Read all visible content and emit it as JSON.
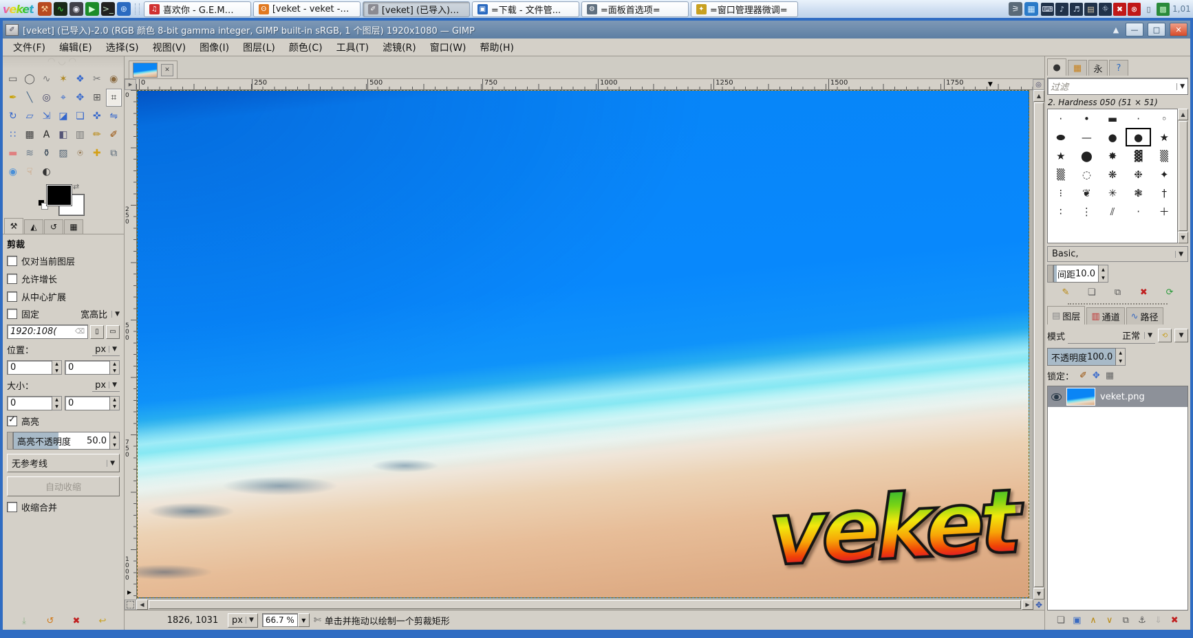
{
  "taskbar": {
    "logo": "veket",
    "launchers": [
      {
        "n": "setup-hammer-icon",
        "g": "⚒",
        "bg": "#b84a20",
        "c": "#ffd8a0"
      },
      {
        "n": "system-monitor-icon",
        "g": "∿",
        "bg": "#1a2a1a",
        "c": "#40e040"
      },
      {
        "n": "media-player-icon",
        "g": "◉",
        "bg": "#404048",
        "c": "#e8e8f0"
      },
      {
        "n": "play-green-icon",
        "g": "▶",
        "bg": "#1c8c28",
        "c": "#d8ffd8"
      },
      {
        "n": "terminal-icon",
        "g": ">_",
        "bg": "#202020",
        "c": "#c0e0c0"
      },
      {
        "n": "browser-globe-icon",
        "g": "⊕",
        "bg": "#2a6ac0",
        "c": "#cfe6ff"
      }
    ],
    "windows": [
      {
        "icon": "♫",
        "bg": "#d03030",
        "label": "喜欢你 - G.E.M…",
        "cls": ""
      },
      {
        "icon": "ʘ",
        "bg": "#e07820",
        "label": "[veket - veket -…",
        "cls": ""
      },
      {
        "icon": "✐",
        "bg": "#8a8a92",
        "label": "[veket] (已导入)…",
        "cls": "active"
      },
      {
        "icon": "▣",
        "bg": "#2a6ac0",
        "label": "=下载 - 文件管...",
        "cls": ""
      },
      {
        "icon": "⚙",
        "bg": "#607080",
        "label": "=面板首选项=",
        "cls": ""
      },
      {
        "icon": "✦",
        "bg": "#c8a020",
        "label": "=窗口管理器微调=",
        "cls": ""
      }
    ],
    "extra_buttons": [
      {
        "n": "screenshot-tool-icon",
        "g": "⚞",
        "bg": "#5a6a78",
        "c": "#e8eef4"
      },
      {
        "n": "wallpaper-preview-icon",
        "g": "▦",
        "bg": "#2a7ac8",
        "c": "#d0ecff"
      }
    ],
    "tray": [
      {
        "n": "keyboard-layout-icon",
        "g": "⌨",
        "bg": "#20324a",
        "c": "#e8f0ff"
      },
      {
        "n": "volume-icon",
        "g": "♪",
        "bg": "#20324a",
        "c": "#cfe0f4"
      },
      {
        "n": "mixer-icon",
        "g": "♬",
        "bg": "#20324a",
        "c": "#cfe0f4"
      },
      {
        "n": "clipboard-tray-icon",
        "g": "▤",
        "bg": "#20324a",
        "c": "#d8c8a8"
      },
      {
        "n": "network-signal-icon",
        "g": "⛗",
        "bg": "#20324a",
        "c": "#cfe0f4"
      },
      {
        "n": "firewall-x-icon",
        "g": "✖",
        "bg": "#c01818",
        "c": "#ffffff"
      },
      {
        "n": "blocked-x-icon",
        "g": "⊗",
        "bg": "#c01818",
        "c": "#ffffff"
      },
      {
        "n": "clipboard-icon",
        "g": "▯",
        "bg": "transparent",
        "c": "#4a5a68"
      },
      {
        "n": "cpu-chip-icon",
        "g": "▩",
        "bg": "#2a8a3a",
        "c": "#bff0c0"
      }
    ],
    "clock": "1,01"
  },
  "window": {
    "title": "[veket] (已导入)-2.0 (RGB 颜色 8-bit gamma integer, GIMP built-in sRGB, 1 个图层) 1920x1080 — GIMP",
    "shade_glyph": "▲",
    "minimize_glyph": "—",
    "maximize_glyph": "□",
    "close_glyph": "✕",
    "menus": [
      "文件(F)",
      "编辑(E)",
      "选择(S)",
      "视图(V)",
      "图像(I)",
      "图层(L)",
      "颜色(C)",
      "工具(T)",
      "滤镜(R)",
      "窗口(W)",
      "帮助(H)"
    ]
  },
  "toolbox": {
    "tools": [
      {
        "n": "rect-select-tool",
        "g": "▭",
        "c": "#555",
        "cls": ""
      },
      {
        "n": "ellipse-select-tool",
        "g": "◯",
        "c": "#555",
        "cls": ""
      },
      {
        "n": "free-select-tool",
        "g": "∿",
        "c": "#777",
        "cls": ""
      },
      {
        "n": "fuzzy-select-tool",
        "g": "✶",
        "c": "#b08820",
        "cls": ""
      },
      {
        "n": "select-by-color-tool",
        "g": "❖",
        "c": "#3366cc",
        "cls": ""
      },
      {
        "n": "scissors-select-tool",
        "g": "✂",
        "c": "#777",
        "cls": ""
      },
      {
        "n": "foreground-select-tool",
        "g": "◉",
        "c": "#8a6a40",
        "cls": ""
      },
      {
        "n": "paths-tool",
        "g": "✒",
        "c": "#c8a000",
        "cls": ""
      },
      {
        "n": "color-picker-tool",
        "g": "╲",
        "c": "#446688",
        "cls": ""
      },
      {
        "n": "zoom-tool",
        "g": "◎",
        "c": "#446",
        "cls": ""
      },
      {
        "n": "measure-tool",
        "g": "⌖",
        "c": "#36c",
        "cls": ""
      },
      {
        "n": "move-tool",
        "g": "✥",
        "c": "#36c",
        "cls": ""
      },
      {
        "n": "align-tool",
        "g": "⊞",
        "c": "#555",
        "cls": ""
      },
      {
        "n": "crop-tool",
        "g": "⌗",
        "c": "#333",
        "cls": "selected"
      },
      {
        "n": "rotate-tool",
        "g": "↻",
        "c": "#36c",
        "cls": ""
      },
      {
        "n": "shear-tool",
        "g": "▱",
        "c": "#36c",
        "cls": ""
      },
      {
        "n": "scale-tool",
        "g": "⇲",
        "c": "#36c",
        "cls": ""
      },
      {
        "n": "perspective-tool",
        "g": "◪",
        "c": "#36c",
        "cls": ""
      },
      {
        "n": "unified-transform-tool",
        "g": "❏",
        "c": "#36c",
        "cls": ""
      },
      {
        "n": "handle-transform-tool",
        "g": "✜",
        "c": "#36c",
        "cls": ""
      },
      {
        "n": "flip-tool",
        "g": "⇋",
        "c": "#36c",
        "cls": ""
      },
      {
        "n": "cage-transform-tool",
        "g": "∷",
        "c": "#36c",
        "cls": ""
      },
      {
        "n": "warp-transform-tool",
        "g": "▩",
        "c": "#444",
        "cls": ""
      },
      {
        "n": "text-tool",
        "g": "A",
        "c": "#222",
        "cls": ""
      },
      {
        "n": "bucket-fill-tool",
        "g": "◧",
        "c": "#557",
        "cls": ""
      },
      {
        "n": "gradient-tool",
        "g": "▥",
        "c": "#777",
        "cls": ""
      },
      {
        "n": "pencil-tool",
        "g": "✏",
        "c": "#b8860b",
        "cls": ""
      },
      {
        "n": "paintbrush-tool",
        "g": "✐",
        "c": "#964b00",
        "cls": ""
      },
      {
        "n": "eraser-tool",
        "g": "▬",
        "c": "#e08080",
        "cls": ""
      },
      {
        "n": "airbrush-tool",
        "g": "≋",
        "c": "#678",
        "cls": ""
      },
      {
        "n": "ink-tool",
        "g": "⚱",
        "c": "#345",
        "cls": ""
      },
      {
        "n": "mypaint-brush-tool",
        "g": "▨",
        "c": "#567",
        "cls": ""
      },
      {
        "n": "clone-tool",
        "g": "⍟",
        "c": "#8a6a40",
        "cls": ""
      },
      {
        "n": "heal-tool",
        "g": "✚",
        "c": "#d4a017",
        "cls": ""
      },
      {
        "n": "perspective-clone-tool",
        "g": "⧉",
        "c": "#567",
        "cls": ""
      },
      {
        "n": "blur-sharpen-tool",
        "g": "◉",
        "c": "#4a90d8",
        "cls": ""
      },
      {
        "n": "smudge-tool",
        "g": "☟",
        "c": "#c89060",
        "cls": ""
      },
      {
        "n": "dodge-burn-tool",
        "g": "◐",
        "c": "#333",
        "cls": ""
      }
    ],
    "bottom_buttons": [
      {
        "n": "save-tool-options-button",
        "g": "⤓",
        "c": "#3a8a3a",
        "cls": "disabled-ico"
      },
      {
        "n": "restore-tool-options-button",
        "g": "↺",
        "c": "#d07818",
        "cls": ""
      },
      {
        "n": "delete-tool-options-button",
        "g": "✖",
        "c": "#c02020",
        "cls": ""
      },
      {
        "n": "reset-tool-options-button",
        "g": "↩",
        "c": "#c8a020",
        "cls": ""
      }
    ]
  },
  "tool_options": {
    "tabs": [
      {
        "n": "tab-tool-options",
        "g": "⚒",
        "cls": "active"
      },
      {
        "n": "tab-device-status",
        "g": "◭",
        "cls": ""
      },
      {
        "n": "tab-undo-history",
        "g": "↺",
        "cls": ""
      },
      {
        "n": "tab-image-thumb",
        "g": "▦",
        "cls": ""
      }
    ],
    "title": "剪裁",
    "checkboxes": [
      {
        "label": "仅对当前图层"
      },
      {
        "label": "允许增长"
      },
      {
        "label": "从中心扩展"
      }
    ],
    "fixed_label": "固定",
    "fixed_mode": "宽高比",
    "ratio_value": "1920:108(",
    "ratio_clear_glyph": "⌫",
    "position_label": "位置：",
    "position_unit": "px",
    "position_x": "0",
    "position_y": "0",
    "size_label": "大小：",
    "size_unit": "px",
    "size_x": "0",
    "size_y": "0",
    "highlight_label": "高亮",
    "highlight_opacity_label": "高亮不透明度",
    "highlight_opacity_value": "50.0",
    "guides_value": "无参考线",
    "autoshrink_label": "自动收缩",
    "shrink_merged_label": "收缩合并"
  },
  "canvas": {
    "ruler_h": [
      {
        "t": "0",
        "x": "0.3%"
      },
      {
        "t": "250",
        "x": "12.9%"
      },
      {
        "t": "500",
        "x": "25.8%"
      },
      {
        "t": "750",
        "x": "38.6%"
      },
      {
        "t": "1000",
        "x": "51.5%"
      },
      {
        "t": "1250",
        "x": "64.4%"
      },
      {
        "t": "1500",
        "x": "77.2%"
      },
      {
        "t": "1750",
        "x": "90.1%"
      }
    ],
    "ruler_v": [
      {
        "t": "0",
        "y": "0.5%"
      },
      {
        "t": "250",
        "y": "22.9%"
      },
      {
        "t": "500",
        "y": "45.8%"
      },
      {
        "t": "750",
        "y": "68.7%"
      },
      {
        "t": "1000",
        "y": "91.6%"
      }
    ],
    "image_text": "veket",
    "tab_close_glyph": "✕"
  },
  "statusbar": {
    "position": "1826, 1031",
    "unit": "px",
    "zoom": "66.7 %",
    "hint": "单击并拖动以绘制一个剪裁矩形"
  },
  "brushes": {
    "tabs": [
      {
        "n": "tab-brushes",
        "g": "●",
        "cls": "active",
        "c": "#333"
      },
      {
        "n": "tab-patterns",
        "g": "▦",
        "cls": "",
        "c": "#c8821e"
      },
      {
        "n": "tab-fonts",
        "g": "永",
        "cls": "",
        "c": "#222"
      },
      {
        "n": "tab-document-history",
        "g": "?",
        "cls": "",
        "c": "#2a6ac0"
      }
    ],
    "filter_placeholder": "过滤",
    "selected_label": "2. Hardness 050 (51 × 51)",
    "items": [
      {
        "g": "·",
        "cls": ""
      },
      {
        "g": "•",
        "cls": ""
      },
      {
        "g": "▬",
        "cls": ""
      },
      {
        "g": "·",
        "cls": ""
      },
      {
        "g": "◦",
        "cls": ""
      },
      {
        "g": "⬬",
        "cls": ""
      },
      {
        "g": "—",
        "cls": ""
      },
      {
        "g": "●",
        "cls": ""
      },
      {
        "g": "●",
        "cls": "selected"
      },
      {
        "g": "★",
        "cls": ""
      },
      {
        "g": "★",
        "cls": ""
      },
      {
        "g": "⬤",
        "cls": ""
      },
      {
        "g": "✸",
        "cls": ""
      },
      {
        "g": "▓",
        "cls": ""
      },
      {
        "g": "▒",
        "cls": ""
      },
      {
        "g": "▒",
        "cls": ""
      },
      {
        "g": "◌",
        "cls": ""
      },
      {
        "g": "❋",
        "cls": ""
      },
      {
        "g": "❉",
        "cls": ""
      },
      {
        "g": "✦",
        "cls": ""
      },
      {
        "g": "⁝",
        "cls": ""
      },
      {
        "g": "❦",
        "cls": ""
      },
      {
        "g": "✳",
        "cls": ""
      },
      {
        "g": "❃",
        "cls": ""
      },
      {
        "g": "†",
        "cls": ""
      },
      {
        "g": "∶",
        "cls": ""
      },
      {
        "g": "⋮",
        "cls": ""
      },
      {
        "g": "⫽",
        "cls": ""
      },
      {
        "g": "·",
        "cls": ""
      },
      {
        "g": "＋",
        "cls": ""
      }
    ],
    "set_value": "Basic,",
    "spacing_label": "间距",
    "spacing_value": "10.0",
    "buttons": [
      {
        "n": "edit-brush-button",
        "g": "✎",
        "c": "#b8860b",
        "cls": ""
      },
      {
        "n": "new-brush-button",
        "g": "❏",
        "c": "#555",
        "cls": ""
      },
      {
        "n": "duplicate-brush-button",
        "g": "⧉",
        "c": "#555",
        "cls": ""
      },
      {
        "n": "delete-brush-button",
        "g": "✖",
        "c": "#c02020",
        "cls": ""
      },
      {
        "n": "refresh-brushes-button",
        "g": "⟳",
        "c": "#2a9a3a",
        "cls": ""
      }
    ]
  },
  "layers": {
    "tabs": [
      {
        "n": "tab-layers",
        "g": "▤",
        "label": "图层",
        "cls": "active",
        "c": "#888"
      },
      {
        "n": "tab-channels",
        "g": "▥",
        "label": "通道",
        "cls": "",
        "c": "#c03030"
      },
      {
        "n": "tab-paths",
        "g": "∿",
        "label": "路径",
        "cls": "",
        "c": "#3a6ac0"
      }
    ],
    "mode_label": "模式",
    "mode_value": "正常",
    "opacity_label": "不透明度",
    "opacity_value": "100.0",
    "lock_label": "锁定：",
    "items": [
      {
        "name": "veket.png"
      }
    ],
    "buttons": [
      {
        "n": "new-layer-button",
        "g": "❏",
        "c": "#555",
        "cls": ""
      },
      {
        "n": "new-group-button",
        "g": "▣",
        "c": "#3a6ac0",
        "cls": ""
      },
      {
        "n": "raise-layer-button",
        "g": "∧",
        "c": "#b8860b",
        "cls": ""
      },
      {
        "n": "lower-layer-button",
        "g": "∨",
        "c": "#b8860b",
        "cls": ""
      },
      {
        "n": "duplicate-layer-button",
        "g": "⧉",
        "c": "#555",
        "cls": ""
      },
      {
        "n": "anchor-layer-button",
        "g": "⚓",
        "c": "#555",
        "cls": ""
      },
      {
        "n": "merge-down-button",
        "g": "⇓",
        "c": "#888",
        "cls": "disabled-ico"
      },
      {
        "n": "delete-layer-button",
        "g": "✖",
        "c": "#c02020",
        "cls": ""
      }
    ]
  }
}
